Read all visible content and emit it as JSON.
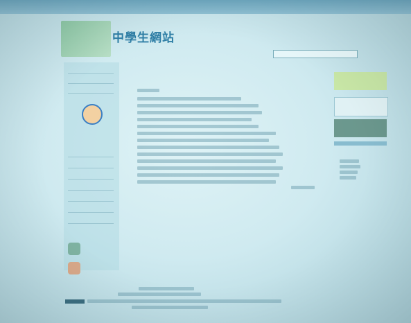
{
  "scene": {
    "type": "photo-of-projected-webpage",
    "site_title": "中學生網站",
    "colors": {
      "screen": "#d6eef2",
      "accent": "#2f7fa6",
      "sidebar": "#aad7e1"
    }
  }
}
